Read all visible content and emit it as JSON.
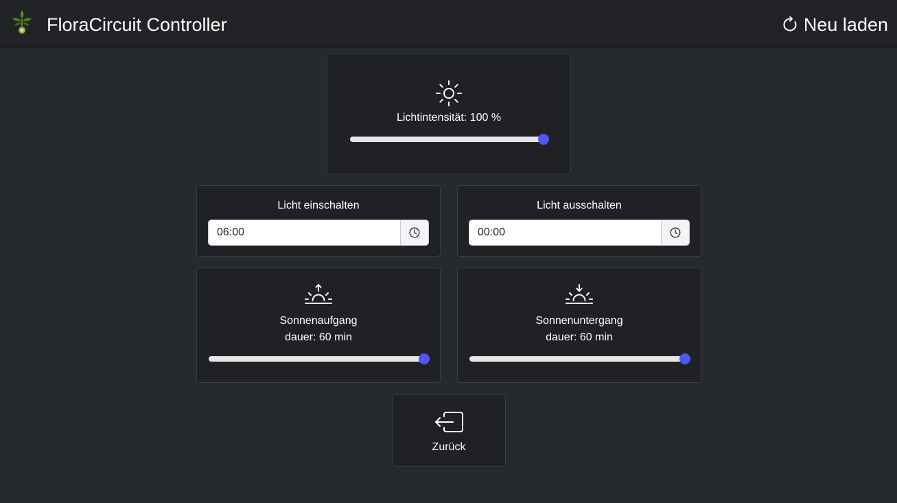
{
  "header": {
    "title": "FloraCircuit Controller",
    "reload_label": "Neu laden"
  },
  "intensity": {
    "icon": "sun-icon",
    "label": "Lichtintensität: 100 %",
    "value": 100
  },
  "light_on": {
    "label": "Licht einschalten",
    "time": "06:00"
  },
  "light_off": {
    "label": "Licht ausschalten",
    "time": "00:00"
  },
  "sunrise": {
    "icon": "sunrise-icon",
    "label_line1": "Sonnenaufgang",
    "label_line2": "dauer: 60 min",
    "value": 100
  },
  "sunset": {
    "icon": "sunset-icon",
    "label_line1": "Sonnenuntergang",
    "label_line2": "dauer: 60 min",
    "value": 100
  },
  "back": {
    "icon": "box-arrow-left-icon",
    "label": "Zurück"
  },
  "colors": {
    "background": "#272a2d",
    "navbar": "#212326",
    "card": "#1f2124",
    "accent": "#4f56f5"
  }
}
